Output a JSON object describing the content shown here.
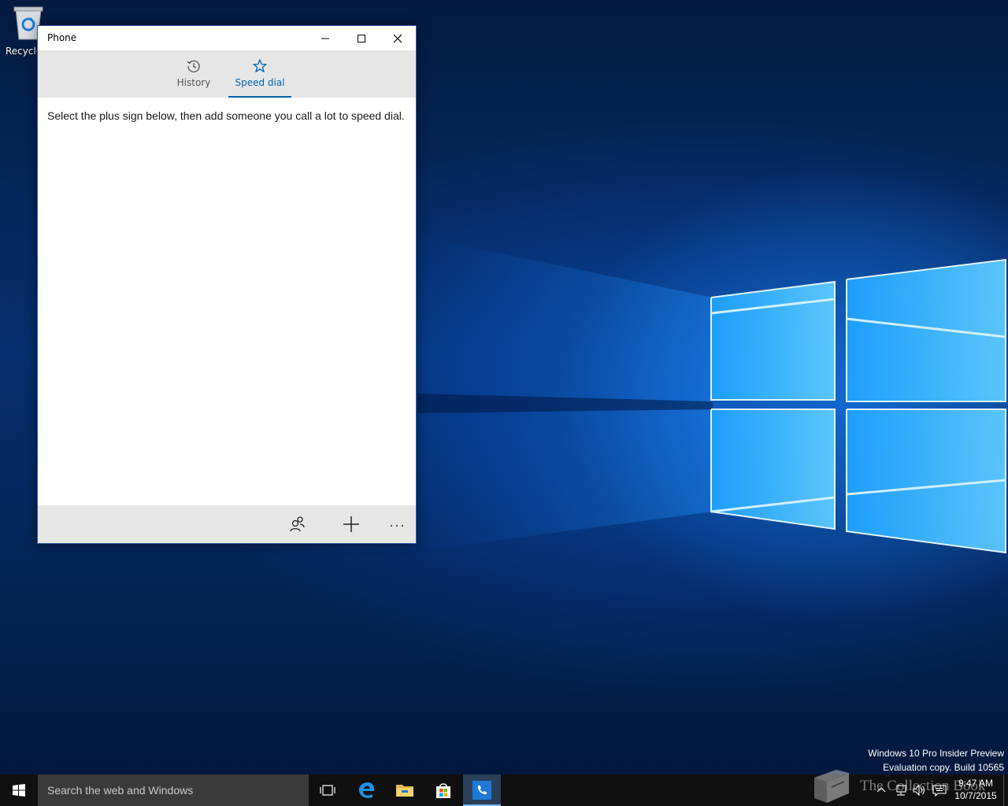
{
  "desktop": {
    "recycle_bin_label": "Recycle",
    "watermark_line1": "Windows 10 Pro Insider Preview",
    "watermark_line2": "Evaluation copy. Build 10565"
  },
  "window": {
    "title": "Phone",
    "controls": {
      "minimize": "minimize-icon",
      "maximize": "maximize-icon",
      "close": "close-icon"
    },
    "tabs": [
      {
        "label": "History",
        "icon": "history-icon",
        "selected": false
      },
      {
        "label": "Speed dial",
        "icon": "star-icon",
        "selected": true
      }
    ],
    "message": "Select the plus sign below, then add someone you call a lot to speed dial.",
    "command_bar": [
      {
        "icon": "contacts-icon"
      },
      {
        "icon": "plus-icon"
      },
      {
        "icon": "more-icon"
      }
    ],
    "accent_color": "#0063b1"
  },
  "taskbar": {
    "search_placeholder": "Search the web and Windows",
    "pinned": [
      "task-view-icon",
      "edge-icon",
      "file-explorer-icon",
      "store-icon",
      "phone-icon"
    ],
    "active_app": "Phone",
    "watermark_text": "The Collection Book",
    "clock_time": "9:47 AM",
    "clock_date": "10/7/2015"
  }
}
